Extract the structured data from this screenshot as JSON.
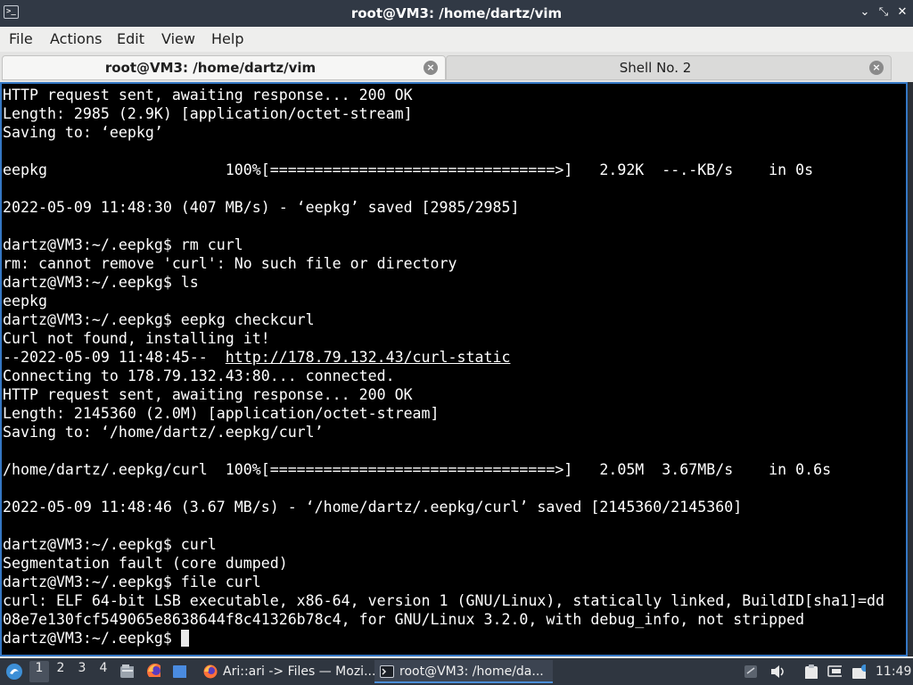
{
  "window": {
    "title": "root@VM3: /home/dartz/vim",
    "controls": [
      "⌄",
      "⤡",
      "✕"
    ]
  },
  "menu": [
    "File",
    "Actions",
    "Edit",
    "View",
    "Help"
  ],
  "tabs": [
    {
      "label": "root@VM3: /home/dartz/vim",
      "active": true
    },
    {
      "label": "Shell No. 2",
      "active": false
    }
  ],
  "terminal": {
    "lines": [
      "HTTP request sent, awaiting response... 200 OK",
      "Length: 2985 (2.9K) [application/octet-stream]",
      "Saving to: ‘eepkg’",
      "",
      "eepkg                    100%[================================>]   2.92K  --.-KB/s    in 0s",
      "",
      "2022-05-09 11:48:30 (407 MB/s) - ‘eepkg’ saved [2985/2985]",
      "",
      "dartz@VM3:~/.eepkg$ rm curl",
      "rm: cannot remove 'curl': No such file or directory",
      "dartz@VM3:~/.eepkg$ ls",
      "eepkg",
      "dartz@VM3:~/.eepkg$ eepkg checkcurl",
      "Curl not found, installing it!",
      "--2022-05-09 11:48:45--  ",
      "Connecting to 178.79.132.43:80... connected.",
      "HTTP request sent, awaiting response... 200 OK",
      "Length: 2145360 (2.0M) [application/octet-stream]",
      "Saving to: ‘/home/dartz/.eepkg/curl’",
      "",
      "/home/dartz/.eepkg/curl  100%[================================>]   2.05M  3.67MB/s    in 0.6s",
      "",
      "2022-05-09 11:48:46 (3.67 MB/s) - ‘/home/dartz/.eepkg/curl’ saved [2145360/2145360]",
      "",
      "dartz@VM3:~/.eepkg$ curl",
      "Segmentation fault (core dumped)",
      "dartz@VM3:~/.eepkg$ file curl",
      "curl: ELF 64-bit LSB executable, x86-64, version 1 (GNU/Linux), statically linked, BuildID[sha1]=dd",
      "08e7e130fcf549065e8638644f8c41326b78c4, for GNU/Linux 3.2.0, with debug_info, not stripped",
      "dartz@VM3:~/.eepkg$ "
    ],
    "link_line_index": 14,
    "link_text": "http://178.79.132.43/curl-static",
    "cursor_line_index": 29
  },
  "taskbar": {
    "workspaces": [
      "1",
      "2",
      "3",
      "4"
    ],
    "current_workspace": "1",
    "tasks": [
      {
        "label": "Ari::ari -> Files — Mozi...",
        "icon": "firefox-icon",
        "active": false
      },
      {
        "label": "root@VM3: /home/da...",
        "icon": "terminal-icon",
        "active": true
      }
    ],
    "clock": "11:49"
  },
  "colors": {
    "titlebar": "#313945",
    "terminal_bg": "#000000",
    "terminal_fg": "#ffffff",
    "focus_border": "#3477c4",
    "taskbar": "#2f3640"
  }
}
